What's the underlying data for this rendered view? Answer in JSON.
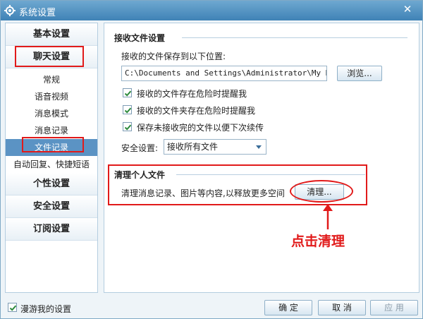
{
  "window": {
    "title": "系统设置",
    "close_glyph": "✕"
  },
  "sidebar": {
    "sections": [
      {
        "label": "基本设置"
      },
      {
        "label": "聊天设置"
      },
      {
        "label": "个性设置"
      },
      {
        "label": "安全设置"
      },
      {
        "label": "订阅设置"
      }
    ],
    "chat_items": [
      {
        "label": "常规"
      },
      {
        "label": "语音视频"
      },
      {
        "label": "消息模式"
      },
      {
        "label": "消息记录"
      },
      {
        "label": "文件记录",
        "selected": true
      },
      {
        "label": "自动回复、快捷短语"
      }
    ]
  },
  "receive": {
    "title": "接收文件设置",
    "path_label": "接收的文件保存到以下位置:",
    "path_value": "C:\\Documents and Settings\\Administrator\\My Documents",
    "browse_label": "浏览...",
    "options": [
      {
        "label": "接收的文件存在危险时提醒我",
        "checked": true
      },
      {
        "label": "接收的文件夹存在危险时提醒我",
        "checked": true
      },
      {
        "label": "保存未接收完的文件以便下次续传",
        "checked": true
      }
    ],
    "security_label": "安全设置:",
    "security_value": "接收所有文件"
  },
  "cleanup": {
    "title": "清理个人文件",
    "description": "清理消息记录、图片等内容,以释放更多空间",
    "button_label": "清理..."
  },
  "annotation": {
    "text": "点击清理",
    "color": "#e11a1a"
  },
  "footer": {
    "roaming_label": "漫游我的设置",
    "roaming_checked": true,
    "ok_label": "确 定",
    "cancel_label": "取 消",
    "apply_label": "应 用"
  },
  "colors": {
    "accent": "#5b93c4",
    "annotation": "#e11a1a"
  },
  "icons": {
    "title": "gear-icon",
    "check": "checkmark-icon",
    "dropdown": "chevron-down-icon",
    "arrow": "arrow-up-icon"
  }
}
